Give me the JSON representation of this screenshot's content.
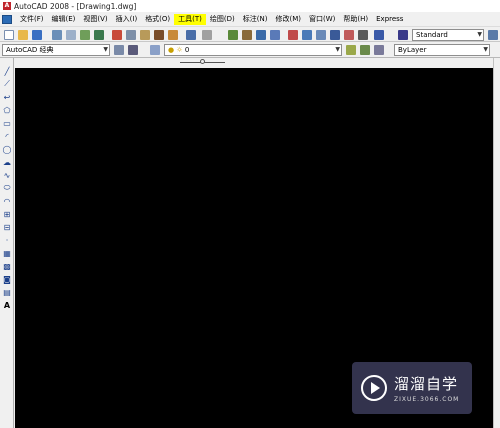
{
  "window": {
    "title": "AutoCAD 2008 - [Drawing1.dwg]"
  },
  "menu": {
    "items": [
      {
        "label": "文件(F)"
      },
      {
        "label": "编辑(E)"
      },
      {
        "label": "视图(V)"
      },
      {
        "label": "插入(I)"
      },
      {
        "label": "格式(O)"
      },
      {
        "label": "工具(T)",
        "highlighted": true
      },
      {
        "label": "绘图(D)"
      },
      {
        "label": "标注(N)"
      },
      {
        "label": "修改(M)"
      },
      {
        "label": "窗口(W)"
      },
      {
        "label": "帮助(H)"
      },
      {
        "label": "Express"
      }
    ]
  },
  "toolbar": {
    "text_style": "Standard",
    "workspace": "AutoCAD 经典",
    "layer": "0",
    "color": "ByLayer"
  },
  "watermark": {
    "title": "溜溜自学",
    "url": "ZIXUE.3066.COM"
  },
  "colors": {
    "canvas": "#000000",
    "menu_highlight": "#ffff00",
    "watermark_bg": "#3c3c5a"
  }
}
